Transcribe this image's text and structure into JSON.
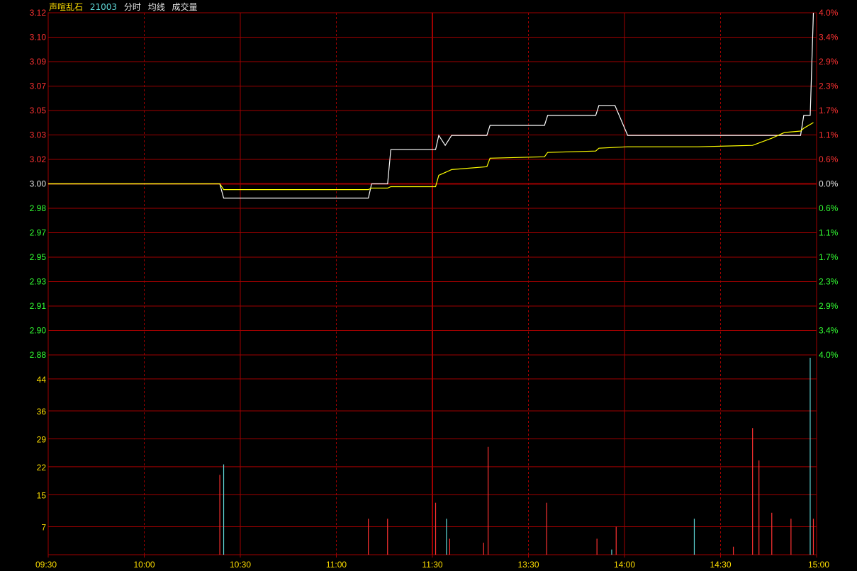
{
  "header": {
    "title": "声喧乱石",
    "code": "21003",
    "legend_intraday": "分时",
    "legend_avg": "均线",
    "legend_volume": "成交量"
  },
  "colors": {
    "up": "#ff3232",
    "down": "#33ff33",
    "grid": "#a00000",
    "price_line": "#ffffff",
    "avg_line": "#ffff00",
    "volume_label": "#ffdf00",
    "volume_up": "#ff3232",
    "volume_down": "#5fd7d7"
  },
  "chart_data": {
    "type": "line",
    "title": "",
    "prev_close": 3.0,
    "y_left_ticks": [
      "3.12",
      "3.10",
      "3.09",
      "3.07",
      "3.05",
      "3.03",
      "3.02",
      "3.00",
      "2.98",
      "2.97",
      "2.95",
      "2.93",
      "2.91",
      "2.90",
      "2.88"
    ],
    "y_right_ticks": [
      "4.0%",
      "3.4%",
      "2.9%",
      "2.3%",
      "1.7%",
      "1.1%",
      "0.6%",
      "0.0%",
      "0.6%",
      "1.1%",
      "1.7%",
      "2.3%",
      "2.9%",
      "3.4%",
      "4.0%"
    ],
    "ylim": [
      2.88,
      3.12
    ],
    "x_ticks": [
      "09:30",
      "10:00",
      "10:30",
      "11:00",
      "11:30",
      "13:30",
      "14:00",
      "14:30",
      "15:00"
    ],
    "x_minutes_total": 240,
    "series": [
      {
        "type": "step",
        "x": [
          0,
          53.6,
          54.8,
          100,
          101,
          106,
          107,
          121,
          122,
          124,
          126,
          137,
          138,
          155,
          156,
          171,
          172,
          177,
          181,
          235,
          236,
          238,
          239
        ],
        "values": [
          3.0,
          3.0,
          2.99,
          2.99,
          3.0,
          3.0,
          3.024,
          3.024,
          3.034,
          3.027,
          3.034,
          3.034,
          3.041,
          3.041,
          3.048,
          3.048,
          3.055,
          3.055,
          3.034,
          3.034,
          3.048,
          3.048,
          3.12
        ]
      },
      {
        "type": "line",
        "x": [
          0,
          53.6,
          54.8,
          100,
          101,
          106,
          107,
          121,
          122,
          124,
          126,
          137,
          138,
          155,
          156,
          171,
          172,
          181,
          203,
          220,
          226,
          230,
          235,
          236,
          239
        ],
        "values": [
          3.0,
          3.0,
          2.996,
          2.996,
          2.997,
          2.997,
          2.998,
          2.998,
          3.006,
          3.008,
          3.01,
          3.012,
          3.018,
          3.019,
          3.022,
          3.023,
          3.025,
          3.026,
          3.026,
          3.027,
          3.032,
          3.036,
          3.037,
          3.039,
          3.043
        ]
      }
    ],
    "volume": {
      "ylim": [
        0,
        50
      ],
      "y_ticks": [
        "44",
        "36",
        "29",
        "22",
        "15",
        "7"
      ],
      "bars": [
        {
          "x": 53.6,
          "v": 20,
          "dir": "up"
        },
        {
          "x": 54.8,
          "v": 22.6,
          "dir": "down"
        },
        {
          "x": 100,
          "v": 9,
          "dir": "up"
        },
        {
          "x": 106,
          "v": 9,
          "dir": "up"
        },
        {
          "x": 121,
          "v": 13,
          "dir": "up"
        },
        {
          "x": 124.4,
          "v": 9,
          "dir": "down"
        },
        {
          "x": 125.4,
          "v": 4,
          "dir": "up"
        },
        {
          "x": 136,
          "v": 3,
          "dir": "up"
        },
        {
          "x": 137.4,
          "v": 27,
          "dir": "up"
        },
        {
          "x": 155.7,
          "v": 13,
          "dir": "up"
        },
        {
          "x": 171.4,
          "v": 4,
          "dir": "up"
        },
        {
          "x": 176,
          "v": 1.3,
          "dir": "down"
        },
        {
          "x": 177.4,
          "v": 7,
          "dir": "up"
        },
        {
          "x": 201.8,
          "v": 9,
          "dir": "down"
        },
        {
          "x": 214,
          "v": 2,
          "dir": "up"
        },
        {
          "x": 220,
          "v": 31.7,
          "dir": "up"
        },
        {
          "x": 222,
          "v": 23.6,
          "dir": "up"
        },
        {
          "x": 226,
          "v": 10.5,
          "dir": "up"
        },
        {
          "x": 232,
          "v": 9,
          "dir": "up"
        },
        {
          "x": 238,
          "v": 49.3,
          "dir": "down"
        },
        {
          "x": 239,
          "v": 9,
          "dir": "up"
        }
      ]
    }
  }
}
